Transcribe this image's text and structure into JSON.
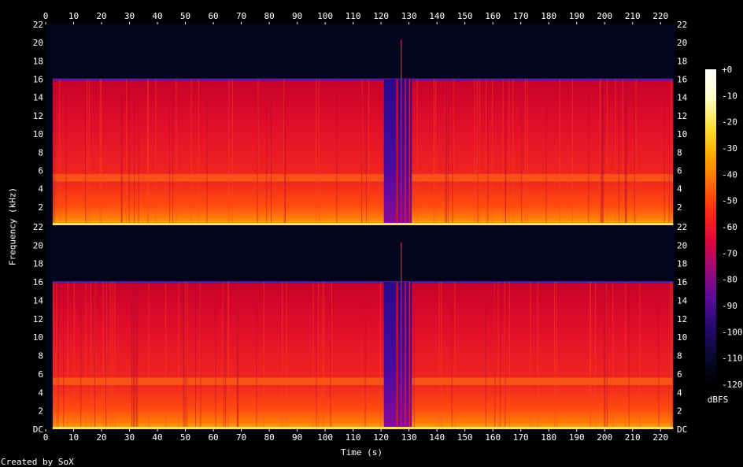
{
  "caption": {
    "credit": "Created by SoX"
  },
  "chart_data": {
    "type": "heatmap",
    "subtype": "spectrogram",
    "channels": 2,
    "xlabel": "Time (s)",
    "ylabel": "Frequency (kHz)",
    "colorbar_label": "dBFS",
    "xlim": [
      0,
      225
    ],
    "ylim_khz": [
      0,
      22
    ],
    "x_ticks": [
      "0",
      "10",
      "20",
      "30",
      "40",
      "50",
      "60",
      "70",
      "80",
      "90",
      "100",
      "110",
      "120",
      "130",
      "140",
      "150",
      "160",
      "170",
      "180",
      "190",
      "200",
      "210",
      "220"
    ],
    "y_ticks_top": [
      "2",
      "4",
      "6",
      "8",
      "10",
      "12",
      "14",
      "16",
      "18",
      "20",
      "22"
    ],
    "y_ticks_bottom": [
      "DC",
      "2",
      "4",
      "6",
      "8",
      "10",
      "12",
      "14",
      "16",
      "18",
      "20",
      "22"
    ],
    "colorbar_ticks": [
      "+0",
      "-10",
      "-20",
      "-30",
      "-40",
      "-50",
      "-60",
      "-70",
      "-80",
      "-90",
      "-100",
      "-110",
      "-120"
    ],
    "colorbar_range_db": [
      -120,
      0
    ],
    "signal_start_s": 2.5,
    "signal_end_s": 224.5,
    "lowpass_cutoff_khz": 16,
    "quiet_section_s": [
      121,
      131
    ],
    "spike_time_s": 127,
    "spike_top_khz": 20.3,
    "band_khz": [
      4.8,
      5.6
    ],
    "colormap": [
      "#000000",
      "#0a0a30",
      "#240a6e",
      "#5a0a96",
      "#9a0a7a",
      "#d80a3c",
      "#ff2a14",
      "#ff6a0a",
      "#ffaa00",
      "#ffe040",
      "#ffffc8",
      "#ffffff"
    ]
  }
}
